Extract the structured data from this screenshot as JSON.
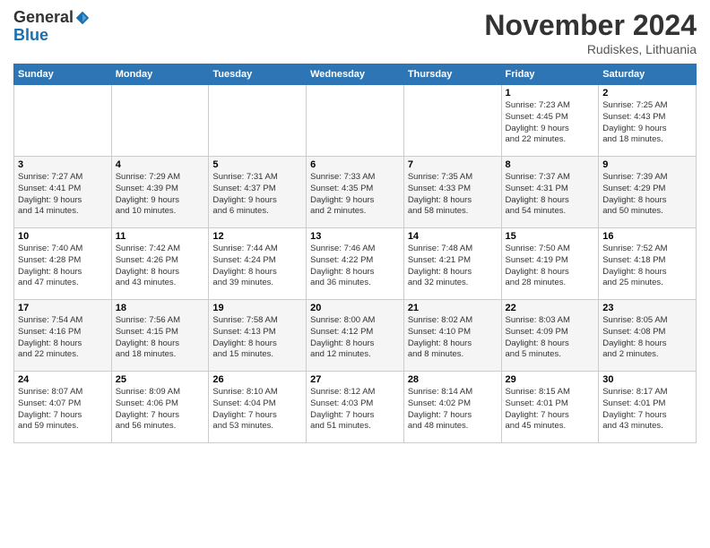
{
  "header": {
    "logo_line1": "General",
    "logo_line2": "Blue",
    "month": "November 2024",
    "location": "Rudiskes, Lithuania"
  },
  "days_of_week": [
    "Sunday",
    "Monday",
    "Tuesday",
    "Wednesday",
    "Thursday",
    "Friday",
    "Saturday"
  ],
  "weeks": [
    [
      {
        "day": "",
        "info": ""
      },
      {
        "day": "",
        "info": ""
      },
      {
        "day": "",
        "info": ""
      },
      {
        "day": "",
        "info": ""
      },
      {
        "day": "",
        "info": ""
      },
      {
        "day": "1",
        "info": "Sunrise: 7:23 AM\nSunset: 4:45 PM\nDaylight: 9 hours\nand 22 minutes."
      },
      {
        "day": "2",
        "info": "Sunrise: 7:25 AM\nSunset: 4:43 PM\nDaylight: 9 hours\nand 18 minutes."
      }
    ],
    [
      {
        "day": "3",
        "info": "Sunrise: 7:27 AM\nSunset: 4:41 PM\nDaylight: 9 hours\nand 14 minutes."
      },
      {
        "day": "4",
        "info": "Sunrise: 7:29 AM\nSunset: 4:39 PM\nDaylight: 9 hours\nand 10 minutes."
      },
      {
        "day": "5",
        "info": "Sunrise: 7:31 AM\nSunset: 4:37 PM\nDaylight: 9 hours\nand 6 minutes."
      },
      {
        "day": "6",
        "info": "Sunrise: 7:33 AM\nSunset: 4:35 PM\nDaylight: 9 hours\nand 2 minutes."
      },
      {
        "day": "7",
        "info": "Sunrise: 7:35 AM\nSunset: 4:33 PM\nDaylight: 8 hours\nand 58 minutes."
      },
      {
        "day": "8",
        "info": "Sunrise: 7:37 AM\nSunset: 4:31 PM\nDaylight: 8 hours\nand 54 minutes."
      },
      {
        "day": "9",
        "info": "Sunrise: 7:39 AM\nSunset: 4:29 PM\nDaylight: 8 hours\nand 50 minutes."
      }
    ],
    [
      {
        "day": "10",
        "info": "Sunrise: 7:40 AM\nSunset: 4:28 PM\nDaylight: 8 hours\nand 47 minutes."
      },
      {
        "day": "11",
        "info": "Sunrise: 7:42 AM\nSunset: 4:26 PM\nDaylight: 8 hours\nand 43 minutes."
      },
      {
        "day": "12",
        "info": "Sunrise: 7:44 AM\nSunset: 4:24 PM\nDaylight: 8 hours\nand 39 minutes."
      },
      {
        "day": "13",
        "info": "Sunrise: 7:46 AM\nSunset: 4:22 PM\nDaylight: 8 hours\nand 36 minutes."
      },
      {
        "day": "14",
        "info": "Sunrise: 7:48 AM\nSunset: 4:21 PM\nDaylight: 8 hours\nand 32 minutes."
      },
      {
        "day": "15",
        "info": "Sunrise: 7:50 AM\nSunset: 4:19 PM\nDaylight: 8 hours\nand 28 minutes."
      },
      {
        "day": "16",
        "info": "Sunrise: 7:52 AM\nSunset: 4:18 PM\nDaylight: 8 hours\nand 25 minutes."
      }
    ],
    [
      {
        "day": "17",
        "info": "Sunrise: 7:54 AM\nSunset: 4:16 PM\nDaylight: 8 hours\nand 22 minutes."
      },
      {
        "day": "18",
        "info": "Sunrise: 7:56 AM\nSunset: 4:15 PM\nDaylight: 8 hours\nand 18 minutes."
      },
      {
        "day": "19",
        "info": "Sunrise: 7:58 AM\nSunset: 4:13 PM\nDaylight: 8 hours\nand 15 minutes."
      },
      {
        "day": "20",
        "info": "Sunrise: 8:00 AM\nSunset: 4:12 PM\nDaylight: 8 hours\nand 12 minutes."
      },
      {
        "day": "21",
        "info": "Sunrise: 8:02 AM\nSunset: 4:10 PM\nDaylight: 8 hours\nand 8 minutes."
      },
      {
        "day": "22",
        "info": "Sunrise: 8:03 AM\nSunset: 4:09 PM\nDaylight: 8 hours\nand 5 minutes."
      },
      {
        "day": "23",
        "info": "Sunrise: 8:05 AM\nSunset: 4:08 PM\nDaylight: 8 hours\nand 2 minutes."
      }
    ],
    [
      {
        "day": "24",
        "info": "Sunrise: 8:07 AM\nSunset: 4:07 PM\nDaylight: 7 hours\nand 59 minutes."
      },
      {
        "day": "25",
        "info": "Sunrise: 8:09 AM\nSunset: 4:06 PM\nDaylight: 7 hours\nand 56 minutes."
      },
      {
        "day": "26",
        "info": "Sunrise: 8:10 AM\nSunset: 4:04 PM\nDaylight: 7 hours\nand 53 minutes."
      },
      {
        "day": "27",
        "info": "Sunrise: 8:12 AM\nSunset: 4:03 PM\nDaylight: 7 hours\nand 51 minutes."
      },
      {
        "day": "28",
        "info": "Sunrise: 8:14 AM\nSunset: 4:02 PM\nDaylight: 7 hours\nand 48 minutes."
      },
      {
        "day": "29",
        "info": "Sunrise: 8:15 AM\nSunset: 4:01 PM\nDaylight: 7 hours\nand 45 minutes."
      },
      {
        "day": "30",
        "info": "Sunrise: 8:17 AM\nSunset: 4:01 PM\nDaylight: 7 hours\nand 43 minutes."
      }
    ]
  ]
}
